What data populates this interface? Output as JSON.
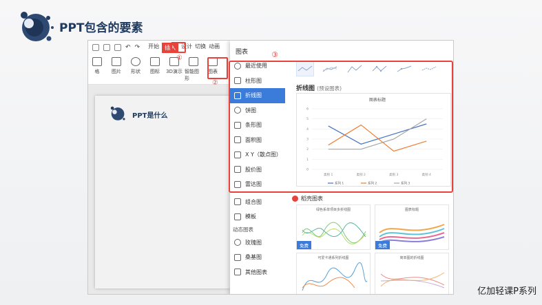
{
  "slide": {
    "title": "PPT包含的要素",
    "brand": "亿加轻课P系列"
  },
  "toolbar": {
    "tabs": [
      "开始",
      "插入",
      "设计",
      "切换",
      "动画"
    ],
    "active_tab": "插入",
    "items": [
      {
        "label": "格",
        "icon": "table-icon"
      },
      {
        "label": "图片",
        "icon": "image-icon"
      },
      {
        "label": "形状",
        "icon": "shape-icon"
      },
      {
        "label": "图标",
        "icon": "icon-icon"
      },
      {
        "label": "3D演示",
        "icon": "cube-icon"
      },
      {
        "label": "智能图形",
        "icon": "smartart-icon"
      },
      {
        "label": "图表",
        "icon": "bar-chart-icon"
      }
    ],
    "markers": [
      "①",
      "②",
      "③"
    ]
  },
  "mini_slide": {
    "title": "PPT是什么"
  },
  "chart_dialog": {
    "title": "图表",
    "categories": [
      {
        "label": "最近使用",
        "icon": "clock-icon"
      },
      {
        "label": "柱形图",
        "icon": "column-chart-icon"
      },
      {
        "label": "折线图",
        "icon": "line-chart-icon",
        "active": true
      },
      {
        "label": "饼图",
        "icon": "pie-chart-icon"
      },
      {
        "label": "条形图",
        "icon": "bar-chart-icon"
      },
      {
        "label": "面积图",
        "icon": "area-chart-icon"
      },
      {
        "label": "X Y（散点图）",
        "icon": "scatter-chart-icon"
      },
      {
        "label": "股价图",
        "icon": "stock-chart-icon"
      },
      {
        "label": "雷达图",
        "icon": "radar-chart-icon"
      },
      {
        "label": "组合图",
        "icon": "combo-chart-icon"
      },
      {
        "label": "模板",
        "icon": "template-icon"
      }
    ],
    "dynamic_head": "动态图表",
    "dynamic": [
      {
        "label": "玫瑰图",
        "icon": "rose-chart-icon"
      },
      {
        "label": "桑基图",
        "icon": "sankey-chart-icon"
      },
      {
        "label": "其他图表",
        "icon": "more-chart-icon"
      }
    ],
    "selected_type": "折线图",
    "selected_note": "(预设图表)",
    "template_head": "稻壳图表",
    "free_label": "免费"
  },
  "chart_data": {
    "type": "line",
    "title": "图表标题",
    "categories": [
      "类别 1",
      "类别 2",
      "类别 3",
      "类别 4"
    ],
    "ylim": [
      0,
      6
    ],
    "yticks": [
      0,
      1,
      2,
      3,
      4,
      5,
      6
    ],
    "series": [
      {
        "name": "系列 1",
        "color": "#4472c4",
        "values": [
          4.3,
          2.5,
          3.5,
          4.5
        ]
      },
      {
        "name": "系列 2",
        "color": "#ed7d31",
        "values": [
          2.4,
          4.4,
          1.8,
          2.8
        ]
      },
      {
        "name": "系列 3",
        "color": "#a5a5a5",
        "values": [
          2.0,
          2.0,
          3.0,
          5.0
        ]
      }
    ],
    "legend": "bottom"
  },
  "templates": [
    {
      "title": "绿色系单项目多折线图"
    },
    {
      "title": "图表标题"
    },
    {
      "title": "可爱卡通系列折线图"
    },
    {
      "title": "简单图的折线图"
    }
  ]
}
